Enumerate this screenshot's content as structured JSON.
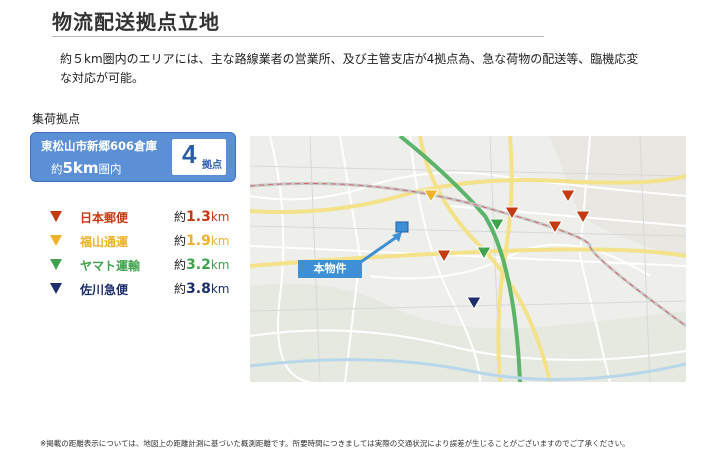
{
  "page": {
    "title": "物流配送拠点立地",
    "intro": "約５km圏内のエリアには、主な路線業者の営業所、及び主管支店が4拠点為、急な荷物の配送等、臨機応変な対応が可能。",
    "section_label": "集荷拠点",
    "footnote": "※掲載の距離表示については、地図上の距離計測に基づいた概測距離です。所要時間につきましては実際の交通状況により誤差が生じることがございますのでご了承ください。"
  },
  "hub": {
    "name": "東松山市新郷606倉庫",
    "radius_prefix": "約",
    "radius_value": "5km",
    "radius_suffix": "圏内",
    "count": "4",
    "count_unit": "拠点"
  },
  "legend": [
    {
      "name": "日本郵便",
      "prefix": "約",
      "distance": "1.3",
      "unit": "km",
      "color": "#c43b12"
    },
    {
      "name": "福山通運",
      "prefix": "約",
      "distance": "1.9",
      "unit": "km",
      "color": "#f0b22a"
    },
    {
      "name": "ヤマト運輸",
      "prefix": "約",
      "distance": "3.2",
      "unit": "km",
      "color": "#3fa34d"
    },
    {
      "name": "佐川急便",
      "prefix": "約",
      "distance": "3.8",
      "unit": "km",
      "color": "#1c2f6b"
    }
  ],
  "map": {
    "property_label": "本物件",
    "property_color": "#3d8fd6",
    "expressway_color": "#5cb36a",
    "major_road_color": "#f3e28a",
    "railway_color": "#d06a6a"
  }
}
